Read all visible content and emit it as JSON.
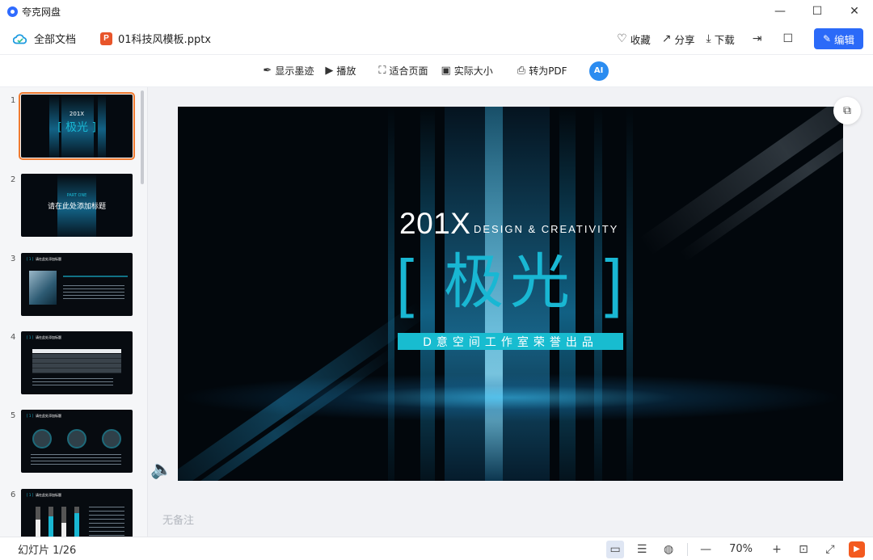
{
  "window": {
    "app_title": "夸克网盘",
    "controls": {
      "minimize": "—",
      "maximize": "☐",
      "close": "✕"
    }
  },
  "header": {
    "home_label": "全部文档",
    "file_name": "01科技风模板.pptx",
    "file_type_badge": "P",
    "actions": {
      "collect_label": "收藏",
      "share_label": "分享",
      "download_label": "下载",
      "edit_label": "编辑"
    }
  },
  "toolbar": {
    "show_ink_label": "显示墨迹",
    "play_label": "播放",
    "fit_page_label": "适合页面",
    "actual_size_label": "实际大小",
    "to_pdf_label": "转为PDF",
    "ai_label": "AI"
  },
  "slides": [
    {
      "number": "1",
      "title": "[ 极光 ]",
      "kicker": "201X",
      "active": true
    },
    {
      "number": "2",
      "title": "请在此处添加标题",
      "kicker": "PART ONE",
      "active": false
    },
    {
      "number": "3",
      "title": "请在此处添加标题",
      "kicker": "[ 1 ]",
      "active": false
    },
    {
      "number": "4",
      "title": "请在此处添加标题",
      "kicker": "[ 1 ]",
      "active": false
    },
    {
      "number": "5",
      "title": "请在此处添加标题",
      "kicker": "[ 1 ]",
      "active": false
    },
    {
      "number": "6",
      "title": "请在此处添加标题",
      "kicker": "[ 1 ]",
      "active": false
    }
  ],
  "current_slide": {
    "year": "201X",
    "tagline": "DESIGN & CREATIVITY",
    "bracket_left": "[",
    "heading": "极光",
    "bracket_right": "]",
    "subtitle": "D意空间工作室荣誉出品"
  },
  "notes_placeholder": "无备注",
  "status": {
    "slide_counter": "幻灯片 1/26",
    "zoom": "70%"
  },
  "colors": {
    "accent": "#2b6af8",
    "slide_cyan": "#19b7d3",
    "thumb_active": "#f07a30",
    "play": "#f35a1f"
  },
  "icons": {
    "cloud": "cloud-icon",
    "heart": "heart-icon",
    "share": "share-icon",
    "download": "download-icon",
    "export": "export-icon",
    "feedback": "feedback-icon",
    "pen": "pen-icon",
    "play": "play-icon",
    "fit": "fit-page-icon",
    "actual": "actual-size-icon",
    "pdf": "pdf-icon"
  }
}
